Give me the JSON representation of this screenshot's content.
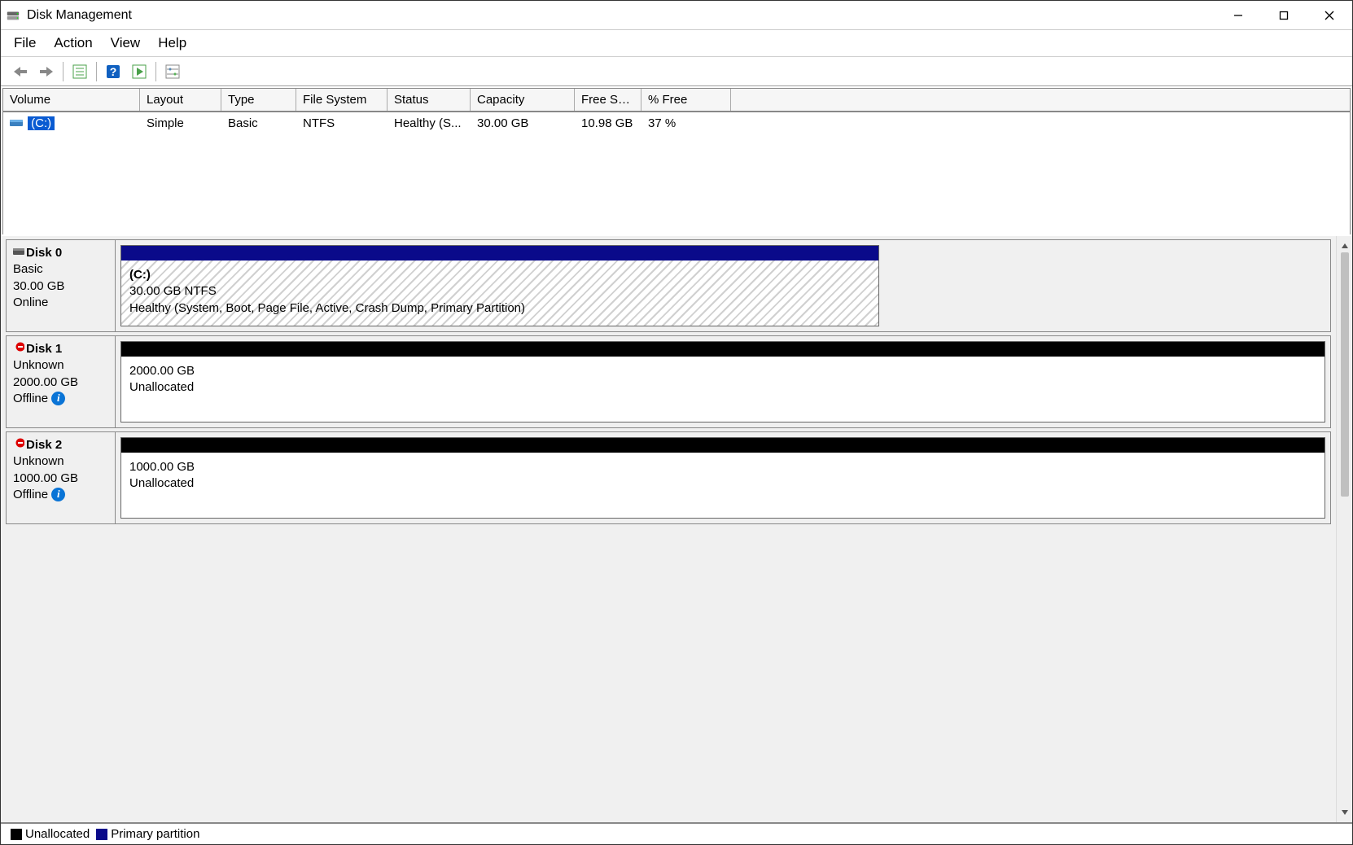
{
  "title": "Disk Management",
  "window": {
    "minimize": "Minimize",
    "maximize": "Maximize",
    "close": "Close"
  },
  "menu": {
    "file": "File",
    "action": "Action",
    "view": "View",
    "help": "Help"
  },
  "toolbar": {
    "back": "Back",
    "forward": "Forward",
    "properties": "Properties",
    "help": "Help",
    "action_btn": "Action",
    "settings": "Settings"
  },
  "volume_headers": {
    "volume": "Volume",
    "layout": "Layout",
    "type": "Type",
    "fs": "File System",
    "status": "Status",
    "capacity": "Capacity",
    "free": "Free Spa...",
    "pct": "% Free"
  },
  "volumes": [
    {
      "name": "(C:)",
      "layout": "Simple",
      "type": "Basic",
      "fs": "NTFS",
      "status": "Healthy (S...",
      "capacity": "30.00 GB",
      "free": "10.98 GB",
      "pct": "37 %"
    }
  ],
  "disks": [
    {
      "name": "Disk 0",
      "kind": "Basic",
      "size": "30.00 GB",
      "state": "Online",
      "error": false,
      "info": false,
      "partitions": [
        {
          "title": "(C:)",
          "line2": "30.00 GB NTFS",
          "line3": "Healthy (System, Boot, Page File, Active, Crash Dump, Primary Partition)",
          "type": "primary",
          "hatched": true,
          "width_pct": 63
        }
      ]
    },
    {
      "name": "Disk 1",
      "kind": "Unknown",
      "size": "2000.00 GB",
      "state": "Offline",
      "error": true,
      "info": true,
      "partitions": [
        {
          "title": "",
          "line2": "2000.00 GB",
          "line3": "Unallocated",
          "type": "unallocated",
          "hatched": false,
          "width_pct": 100
        }
      ]
    },
    {
      "name": "Disk 2",
      "kind": "Unknown",
      "size": "1000.00 GB",
      "state": "Offline",
      "error": true,
      "info": true,
      "partitions": [
        {
          "title": "",
          "line2": "1000.00 GB",
          "line3": "Unallocated",
          "type": "unallocated",
          "hatched": false,
          "width_pct": 100
        }
      ]
    }
  ],
  "legend": {
    "unallocated": "Unallocated",
    "primary": "Primary partition"
  }
}
